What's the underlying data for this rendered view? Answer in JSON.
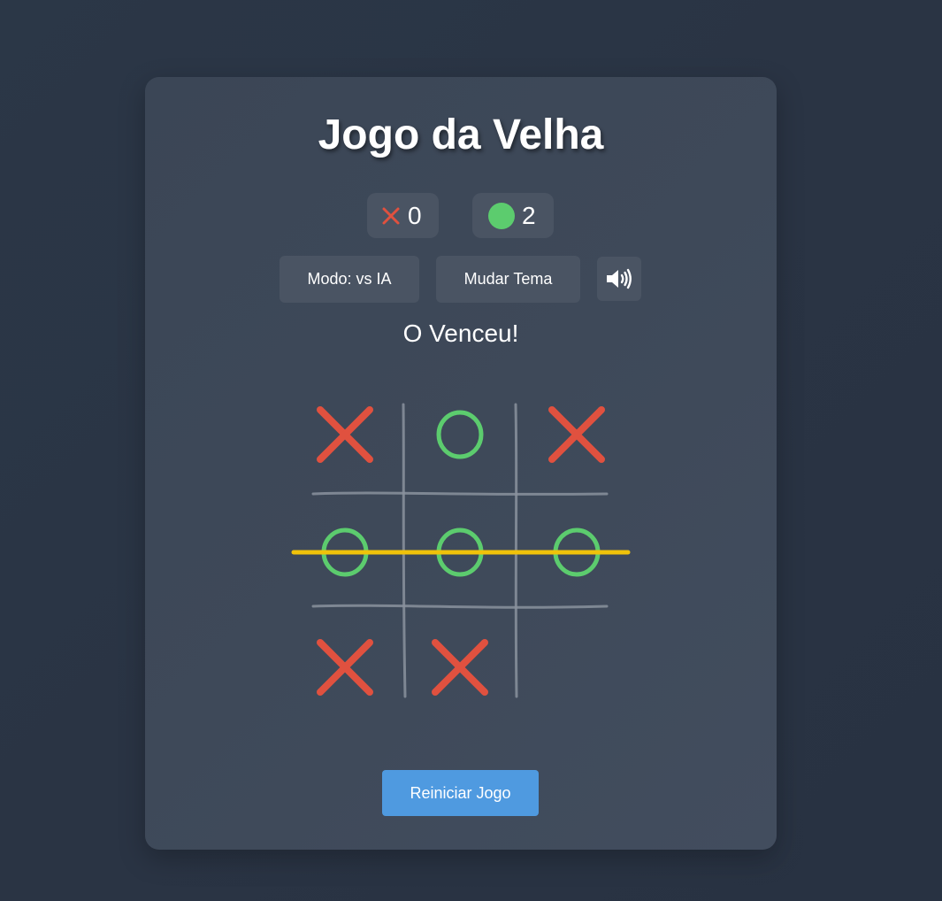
{
  "title": "Jogo da Velha",
  "scores": {
    "x_value": "0",
    "o_value": "2"
  },
  "controls": {
    "mode_label": "Modo: vs IA",
    "theme_label": "Mudar Tema",
    "sound_icon": "speaker-volume-icon"
  },
  "status_text": "O Venceu!",
  "board": {
    "cells": [
      "X",
      "O",
      "X",
      "O",
      "O",
      "O",
      "X",
      "X",
      ""
    ],
    "winning_line": "row-2"
  },
  "restart_label": "Reiniciar Jogo",
  "colors": {
    "x": "#e0513f",
    "o": "#5ccc6e",
    "win_line": "#f0c20a",
    "grid": "#8a929d",
    "accent": "#4f9ae0"
  }
}
